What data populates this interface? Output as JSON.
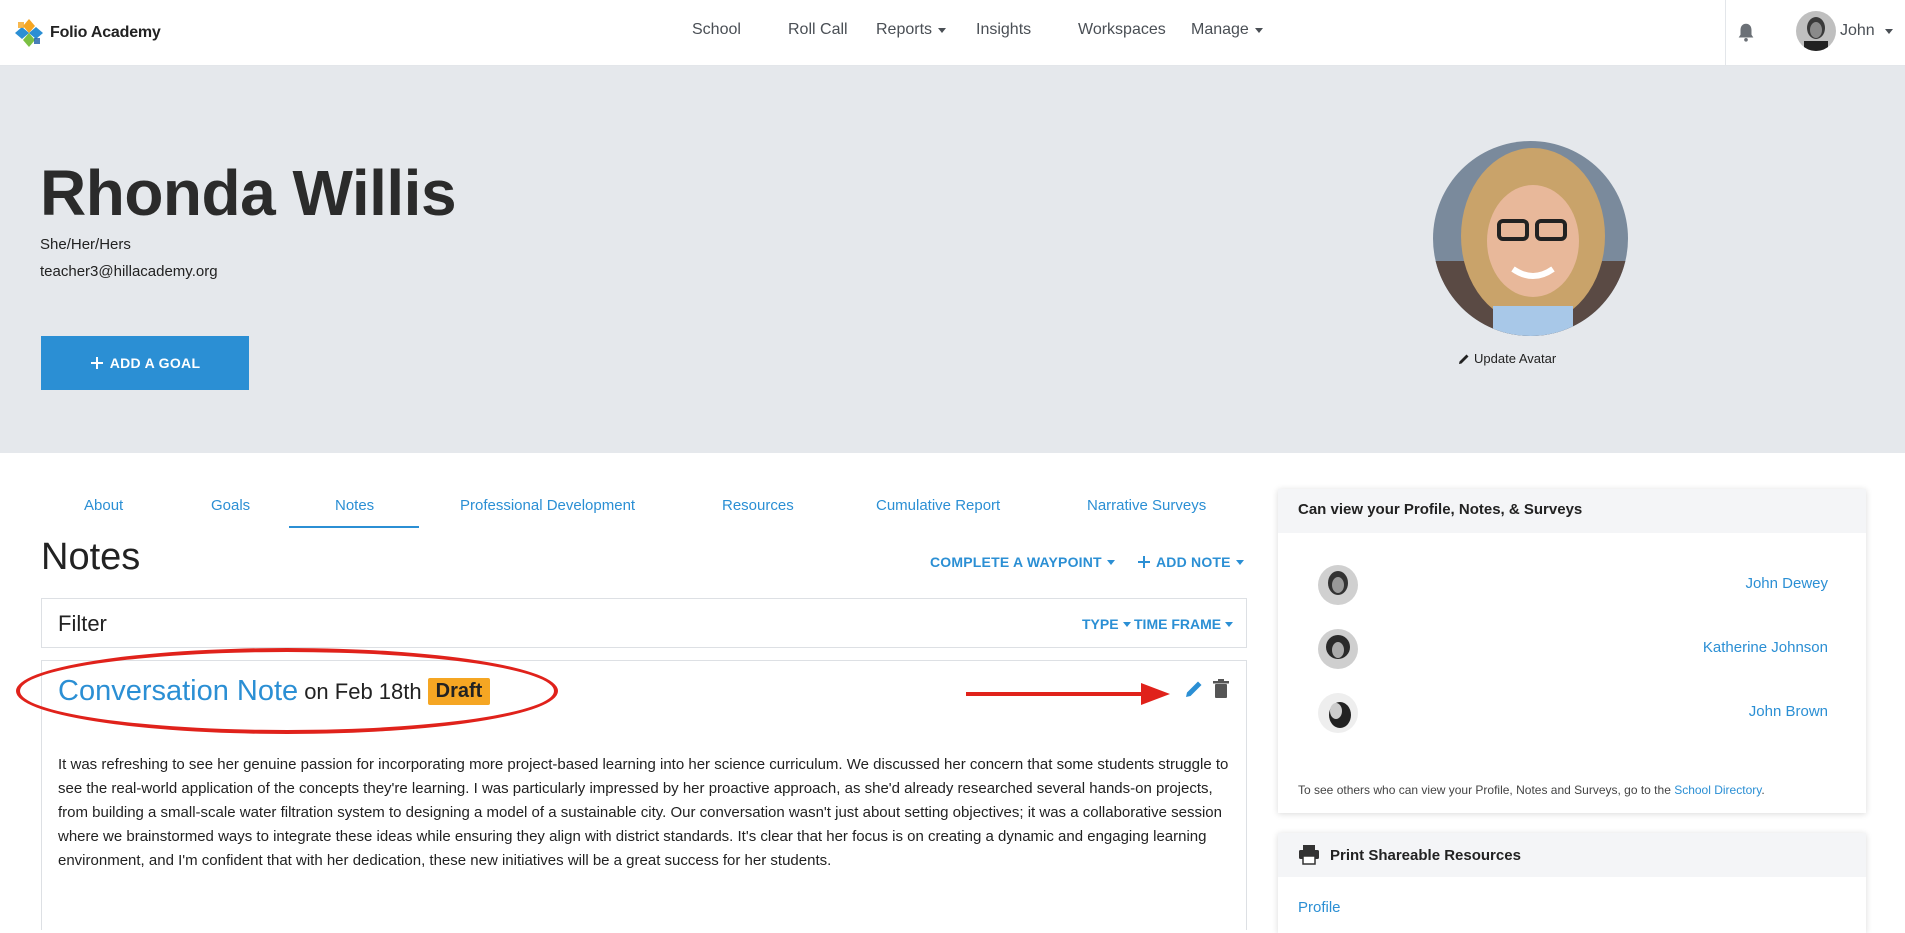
{
  "brand": {
    "name": "Folio Academy"
  },
  "nav": {
    "items": [
      {
        "label": "School"
      },
      {
        "label": "Roll Call"
      },
      {
        "label": "Reports"
      },
      {
        "label": "Insights"
      },
      {
        "label": "Workspaces"
      },
      {
        "label": "Manage"
      }
    ],
    "user_name": "John"
  },
  "profile": {
    "name": "Rhonda Willis",
    "pronouns": "She/Her/Hers",
    "email": "teacher3@hillacademy.org",
    "add_goal_label": "ADD A GOAL",
    "update_avatar_label": "Update Avatar"
  },
  "tabs": [
    {
      "label": "About"
    },
    {
      "label": "Goals"
    },
    {
      "label": "Notes"
    },
    {
      "label": "Professional Development"
    },
    {
      "label": "Resources"
    },
    {
      "label": "Cumulative Report"
    },
    {
      "label": "Narrative Surveys"
    }
  ],
  "notes": {
    "title": "Notes",
    "complete_waypoint_label": "COMPLETE A WAYPOINT",
    "add_note_label": "ADD NOTE",
    "filter_label": "Filter",
    "filter_type_label": "TYPE",
    "filter_time_label": "TIME FRAME",
    "note": {
      "type": "Conversation Note",
      "date": "on Feb 18th",
      "badge": "Draft",
      "body": "It was refreshing to see her genuine passion for incorporating more project-based learning into her science curriculum. We discussed her concern that some students struggle to see the real-world application of the concepts they're learning. I was particularly impressed by her proactive approach, as she'd already researched several hands-on projects, from building a small-scale water filtration system to designing a model of a sustainable city. Our conversation wasn't just about setting objectives; it was a collaborative session where we brainstormed ways to integrate these ideas while ensuring they align with district standards. It's clear that her focus is on creating a dynamic and engaging learning environment, and I'm confident that with her dedication, these new initiatives will be a great success for her students."
    }
  },
  "viewers_panel": {
    "title": "Can view your Profile, Notes, & Surveys",
    "viewers": [
      {
        "name": "John Dewey"
      },
      {
        "name": "Katherine Johnson"
      },
      {
        "name": "John Brown"
      }
    ],
    "footer_text": "To see others who can view your Profile, Notes and Surveys, go to the ",
    "footer_link": "School Directory",
    "footer_end": "."
  },
  "resources_panel": {
    "title": "Print Shareable Resources",
    "link": "Profile"
  },
  "colors": {
    "accent": "#2b8fd4",
    "hero_bg": "#e5e8ec",
    "draft": "#f5a623",
    "annotation": "#e0221b"
  }
}
